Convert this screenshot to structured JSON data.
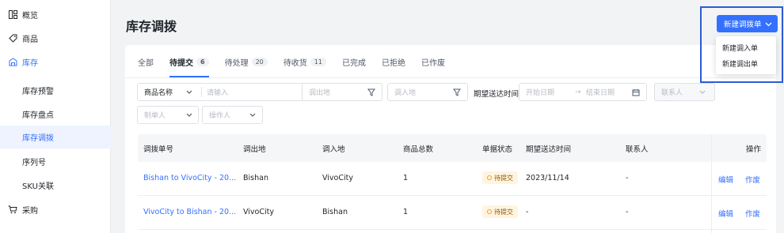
{
  "sidebar": {
    "items": [
      {
        "label": "概览",
        "icon": "grid-icon"
      },
      {
        "label": "商品",
        "icon": "tag-icon"
      },
      {
        "label": "库存",
        "icon": "warehouse-icon"
      },
      {
        "label": "库存预警"
      },
      {
        "label": "库存盘点"
      },
      {
        "label": "库存调拨"
      },
      {
        "label": "序列号"
      },
      {
        "label": "SKU关联"
      },
      {
        "label": "采购",
        "icon": "cart-icon"
      }
    ],
    "active_color": "#3370ff"
  },
  "header": {
    "title": "库存调拨"
  },
  "tabs": [
    {
      "label": "全部",
      "count": ""
    },
    {
      "label": "待提交",
      "count": "6"
    },
    {
      "label": "待处理",
      "count": "20"
    },
    {
      "label": "待收货",
      "count": "11"
    },
    {
      "label": "已完成",
      "count": ""
    },
    {
      "label": "已拒绝",
      "count": ""
    },
    {
      "label": "已作废",
      "count": ""
    }
  ],
  "filters": {
    "search_field": "商品名称",
    "search_placeholder": "请输入",
    "from_placeholder": "调出地",
    "to_placeholder": "调入地",
    "period_label": "期望送达时间",
    "start_date_placeholder": "开始日期",
    "end_date_placeholder": "结束日期",
    "contact_placeholder": "联系人",
    "creator_placeholder": "制单人",
    "operator_placeholder": "操作人"
  },
  "table": {
    "columns": [
      "调拨单号",
      "调出地",
      "调入地",
      "商品总数",
      "单据状态",
      "期望送达时间",
      "联系人",
      "操作"
    ],
    "rows": [
      {
        "id": "Bishan to VivoCity - 20...",
        "from": "Bishan",
        "to": "VivoCity",
        "total": "1",
        "status": "待提交",
        "date": "2023/11/14",
        "contact": "-",
        "edit": "编辑",
        "void": "作废"
      },
      {
        "id": "VivoCity to Bishan - 20...",
        "from": "VivoCity",
        "to": "Bishan",
        "total": "1",
        "status": "待提交",
        "date": "-",
        "contact": "-",
        "edit": "编辑",
        "void": "作废"
      }
    ]
  },
  "new_button": {
    "label": "新建调拨单",
    "menu": [
      "新建调入单",
      "新建调出单"
    ],
    "color": "#3370ff"
  }
}
